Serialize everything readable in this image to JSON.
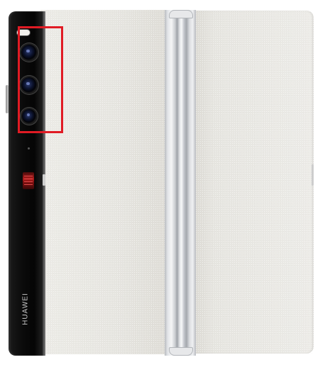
{
  "product": {
    "brand_text": "HUAWEI"
  },
  "highlight": {
    "color": "#e01b24",
    "target": "camera-module"
  },
  "colors": {
    "body_finish": "#e6e5e0",
    "camera_strip": "#0a0a0a",
    "power_key": "#b21d1d"
  }
}
